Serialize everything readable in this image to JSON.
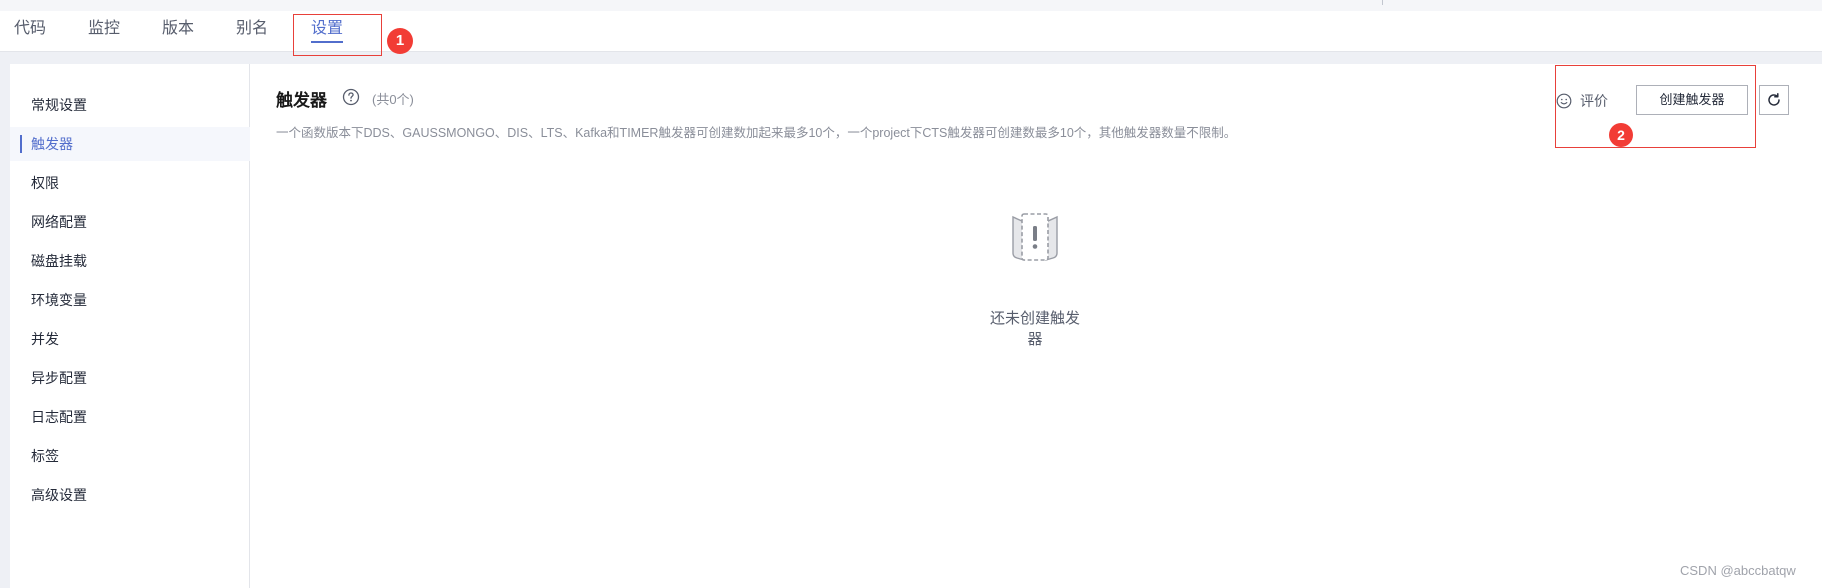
{
  "tabs": [
    {
      "label": "代码"
    },
    {
      "label": "监控"
    },
    {
      "label": "版本"
    },
    {
      "label": "别名"
    },
    {
      "label": "设置",
      "active": true
    }
  ],
  "badges": [
    "1",
    "2"
  ],
  "sidebar": {
    "items": [
      {
        "label": "常规设置"
      },
      {
        "label": "触发器",
        "active": true
      },
      {
        "label": "权限"
      },
      {
        "label": "网络配置"
      },
      {
        "label": "磁盘挂载"
      },
      {
        "label": "环境变量"
      },
      {
        "label": "并发"
      },
      {
        "label": "异步配置"
      },
      {
        "label": "日志配置"
      },
      {
        "label": "标签"
      },
      {
        "label": "高级设置"
      }
    ]
  },
  "main": {
    "title": "触发器",
    "count": "(共0个)",
    "description": "一个函数版本下DDS、GAUSSMONGO、DIS、LTS、Kafka和TIMER触发器可创建数加起来最多10个，一个project下CTS触发器可创建数最多10个，其他触发器数量不限制。",
    "rate_label": "评价",
    "create_button": "创建触发器",
    "empty_text": "还未创建触发器"
  },
  "icons": {
    "help": "question-circle-icon",
    "rate": "smiley-icon",
    "refresh": "refresh-icon",
    "empty": "empty-document-exclamation-icon"
  },
  "colors": {
    "accent": "#526ecc",
    "annotation_red": "#f23c35"
  },
  "watermark": "CSDN @abccbatqw"
}
